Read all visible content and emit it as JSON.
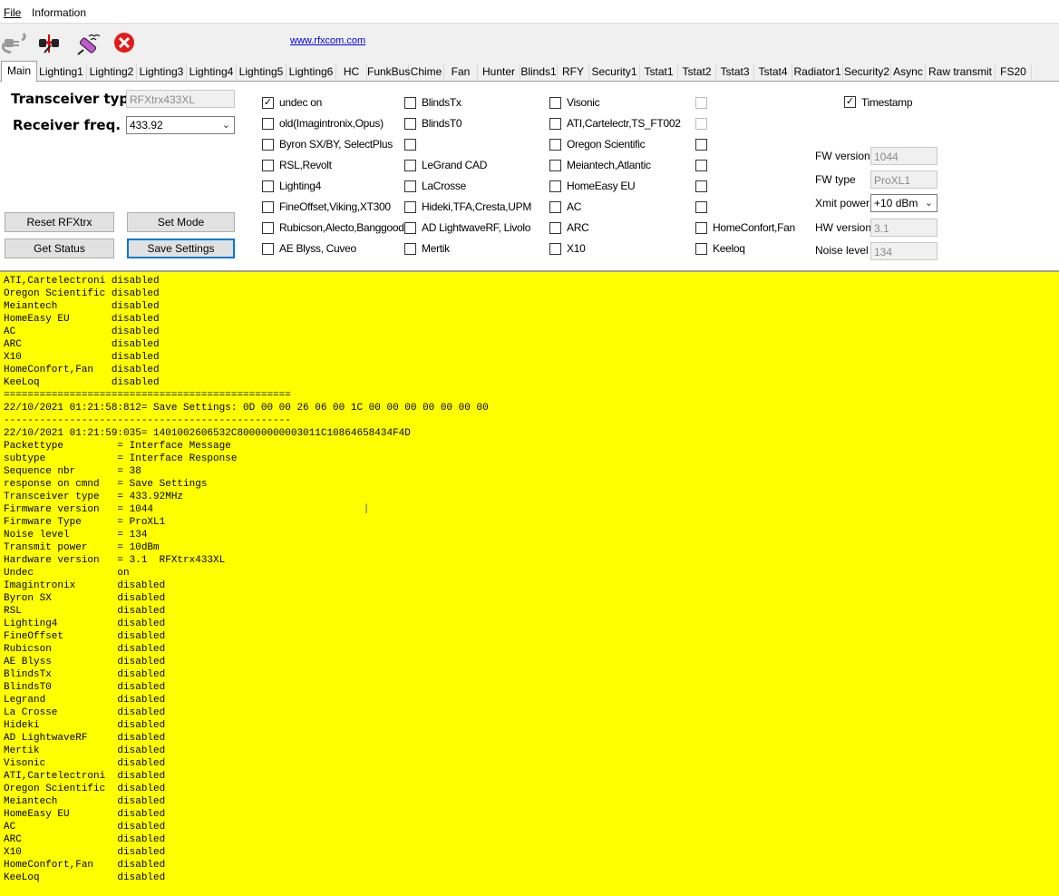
{
  "menu": {
    "file": "File",
    "information": "Information"
  },
  "toolbar": {
    "icons": [
      "plug-icon",
      "connect-icon",
      "satellite-icon",
      "close-icon"
    ],
    "link": "www.rfxcom.com"
  },
  "tabs": [
    "Main",
    "Lighting1",
    "Lighting2",
    "Lighting3",
    "Lighting4",
    "Lighting5",
    "Lighting6",
    "HC",
    "FunkBus",
    "Chime",
    "Fan",
    "Hunter",
    "Blinds1",
    "RFY",
    "Security1",
    "Tstat1",
    "Tstat2",
    "Tstat3",
    "Tstat4",
    "Radiator1",
    "Security2",
    "Async",
    "Raw transmit",
    "FS20"
  ],
  "main": {
    "transceiver_type_label": "Transceiver type",
    "transceiver_type_value": "RFXtrx433XL",
    "receiver_freq_label": "Receiver freq.",
    "receiver_freq_value": "433.92",
    "buttons": {
      "reset": "Reset RFXtrx",
      "set_mode": "Set Mode",
      "get_status": "Get Status",
      "save_settings": "Save Settings"
    },
    "col1": [
      {
        "label": "undec on",
        "checked": true
      },
      {
        "label": "old(Imagintronix,Opus)",
        "checked": false
      },
      {
        "label": "Byron SX/BY, SelectPlus",
        "checked": false
      },
      {
        "label": "RSL,Revolt",
        "checked": false
      },
      {
        "label": "Lighting4",
        "checked": false
      },
      {
        "label": "FineOffset,Viking,XT300",
        "checked": false
      },
      {
        "label": "Rubicson,Alecto,Banggood",
        "checked": false
      },
      {
        "label": "AE Blyss, Cuveo",
        "checked": false
      }
    ],
    "col2": [
      {
        "label": "BlindsTx",
        "checked": false
      },
      {
        "label": "BlindsT0",
        "checked": false
      },
      {
        "label": "",
        "checked": false
      },
      {
        "label": "LeGrand CAD",
        "checked": false
      },
      {
        "label": "LaCrosse",
        "checked": false
      },
      {
        "label": "Hideki,TFA,Cresta,UPM",
        "checked": false
      },
      {
        "label": "AD LightwaveRF, Livolo",
        "checked": false
      },
      {
        "label": "Mertik",
        "checked": false
      }
    ],
    "col3": [
      {
        "label": "Visonic",
        "checked": false
      },
      {
        "label": "ATI,Cartelectr,TS_FT002",
        "checked": false
      },
      {
        "label": "Oregon Scientific",
        "checked": false
      },
      {
        "label": "Meiantech,Atlantic",
        "checked": false
      },
      {
        "label": "HomeEasy EU",
        "checked": false
      },
      {
        "label": "AC",
        "checked": false
      },
      {
        "label": "ARC",
        "checked": false
      },
      {
        "label": "X10",
        "checked": false
      }
    ],
    "col4": [
      {
        "label": "",
        "checked": false
      },
      {
        "label": "",
        "checked": false
      },
      {
        "label": "",
        "checked": false
      },
      {
        "label": "",
        "checked": false
      },
      {
        "label": "",
        "checked": false
      },
      {
        "label": "",
        "checked": false
      },
      {
        "label": "HomeConfort,Fan",
        "checked": false
      },
      {
        "label": "Keeloq",
        "checked": false
      }
    ],
    "timestamp": {
      "label": "Timestamp",
      "checked": true
    },
    "fw_version_label": "FW version",
    "fw_version_value": "1044",
    "fw_type_label": "FW type",
    "fw_type_value": "ProXL1",
    "xmit_power_label": "Xmit power",
    "xmit_power_value": "+10 dBm",
    "hw_version_label": "HW version",
    "hw_version_value": "3.1",
    "noise_level_label": "Noise level",
    "noise_level_value": "134"
  },
  "log": {
    "lines": [
      "ATI,Cartelectroni disabled",
      "Oregon Scientific disabled",
      "Meiantech         disabled",
      "HomeEasy EU       disabled",
      "AC                disabled",
      "ARC               disabled",
      "X10               disabled",
      "HomeConfort,Fan   disabled",
      "KeeLoq            disabled",
      "================================================",
      "22/10/2021 01:21:58:812= Save Settings: 0D 00 00 26 06 00 1C 00 00 00 00 00 00 00",
      "------------------------------------------------",
      "22/10/2021 01:21:59:035= 1401002606532C80000000003011C10864658434F4D",
      "Packettype         = Interface Message",
      "subtype            = Interface Response",
      "Sequence nbr       = 38",
      "response on cmnd   = Save Settings",
      "Transceiver type   = 433.92MHz",
      "Firmware version   = 1044",
      "Firmware Type      = ProXL1",
      "Noise level        = 134",
      "Transmit power     = 10dBm",
      "Hardware version   = 3.1  RFXtrx433XL",
      "Undec              on",
      "Imagintronix       disabled",
      "Byron SX           disabled",
      "RSL                disabled",
      "Lighting4          disabled",
      "FineOffset         disabled",
      "Rubicson           disabled",
      "AE Blyss           disabled",
      "BlindsTx           disabled",
      "BlindsT0           disabled",
      "Legrand            disabled",
      "La Crosse          disabled",
      "Hideki             disabled",
      "AD LightwaveRF     disabled",
      "Mertik             disabled",
      "Visonic            disabled",
      "ATI,Cartelectroni  disabled",
      "Oregon Scientific  disabled",
      "Meiantech          disabled",
      "HomeEasy EU        disabled",
      "AC                 disabled",
      "ARC                disabled",
      "X10                disabled",
      "HomeConfort,Fan    disabled",
      "KeeLoq             disabled"
    ]
  }
}
